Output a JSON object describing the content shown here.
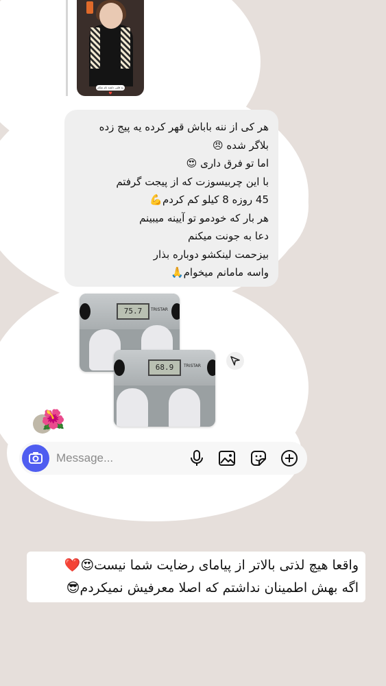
{
  "story": {
    "caption": "یه قلبی دلشه نام تفکم ❤️"
  },
  "message": {
    "lines": [
      "هر کی از ننه باباش قهر کرده یه پیج زده",
      "بلاگر شده 😠",
      "اما تو فرق داری 😍",
      "با این چربیسوزت  که از پیجت گرفتم",
      "45 روزه 8 کیلو کم کردم💪",
      "هر بار که خودمو تو آیینه میبینم",
      "دعا به جونت میکنم",
      "بیزحمت لینکشو دوباره بذار",
      "واسه مامانم میخوام🙏"
    ]
  },
  "photos": {
    "scale_before": {
      "reading": "75.7",
      "brand": "TRISTAR"
    },
    "scale_after": {
      "reading": "68.9",
      "brand": "TRISTAR"
    }
  },
  "reaction": {
    "emoji": "🌺"
  },
  "composer": {
    "placeholder": "Message...",
    "icons": [
      "camera-icon",
      "microphone-icon",
      "gallery-icon",
      "sticker-icon",
      "add-icon"
    ],
    "accent": "#4f5df0"
  },
  "caption": {
    "lines": [
      "واقعا هیچ لذتی بالاتر از پیامای رضایت شما نیست😍❤️",
      "اگه بهش اطمینان نداشتم که اصلا معرفیش نمیکردم😎"
    ]
  },
  "colors": {
    "background": "#e6dfdb",
    "bubble": "#efefef",
    "accent": "#4f5df0"
  }
}
